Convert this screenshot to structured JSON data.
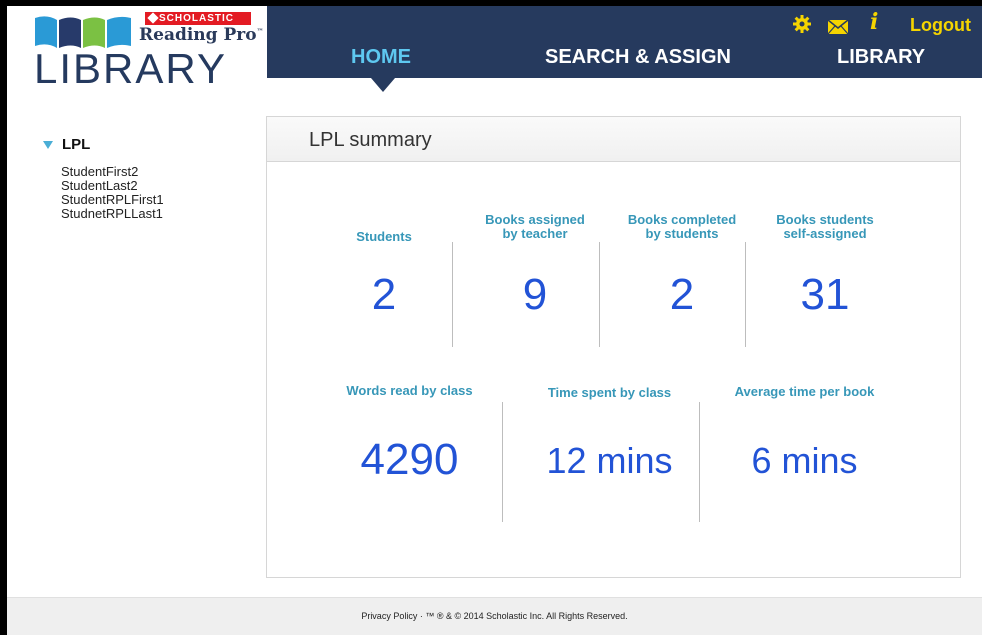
{
  "brand": {
    "publisher": "SCHOLASTIC",
    "product": "Reading Pro",
    "product_mark": "™",
    "name": "LIBRARY"
  },
  "nav": {
    "home": "HOME",
    "search_assign": "SEARCH & ASSIGN",
    "library": "LIBRARY",
    "info": "i",
    "logout": "Logout"
  },
  "sidebar": {
    "group": "LPL",
    "students": [
      "StudentFirst2",
      "StudentLast2",
      "StudentRPLFirst1",
      "StudnetRPLLast1"
    ]
  },
  "summary": {
    "title": "LPL summary",
    "row1": [
      {
        "label": "Students",
        "value": "2"
      },
      {
        "label": "Books assigned\nby teacher",
        "value": "9"
      },
      {
        "label": "Books completed\nby students",
        "value": "2"
      },
      {
        "label": "Books students\nself-assigned",
        "value": "31"
      }
    ],
    "row2": [
      {
        "label": "Words read by class",
        "value": "4290"
      },
      {
        "label": "Time spent by class",
        "value": "12 mins"
      },
      {
        "label": "Average time per book",
        "value": "6 mins"
      }
    ]
  },
  "footer": {
    "text": "Privacy Policy  ·  ™ ® & © 2014 Scholastic Inc. All Rights Reserved."
  },
  "colors": {
    "navbar": "#263a5e",
    "active_nav": "#5ec8f0",
    "utility": "#f5d400",
    "stat_label": "#3797b8",
    "stat_value": "#2253d6"
  },
  "icons": [
    "gear-icon",
    "mail-icon",
    "info-icon",
    "books-logo-icon",
    "expand-triangle-icon"
  ]
}
